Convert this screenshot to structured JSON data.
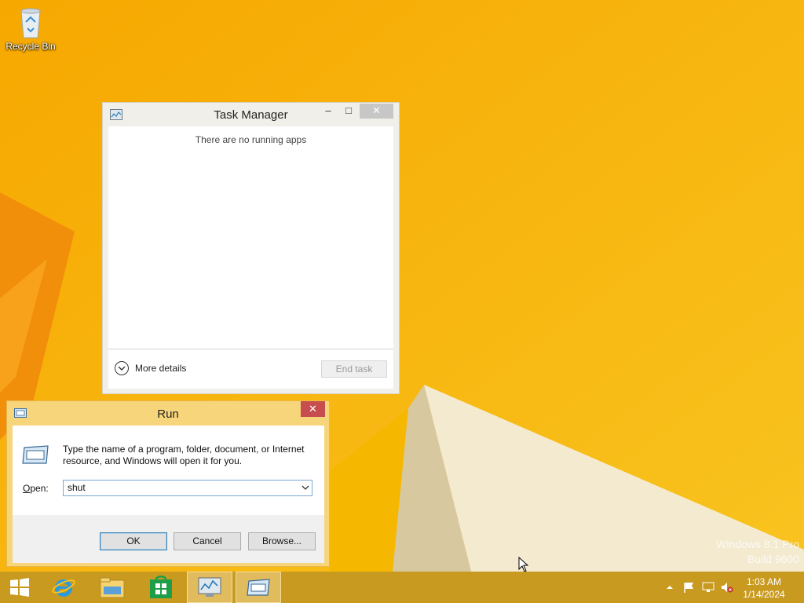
{
  "desktop": {
    "recycle_bin_label": "Recycle Bin",
    "watermark_line1": "Windows 8.1 Pro",
    "watermark_line2": "Build 9600"
  },
  "task_manager": {
    "title": "Task Manager",
    "minimize": "–",
    "maximize": "□",
    "close": "✕",
    "empty_message": "There are no running apps",
    "more_details_label": "More details",
    "end_task_label": "End task"
  },
  "run_dialog": {
    "title": "Run",
    "close": "✕",
    "description": "Type the name of a program, folder, document, or Internet resource, and Windows will open it for you.",
    "open_label_prefix": "O",
    "open_label_rest": "pen:",
    "open_value": "shut",
    "ok_label": "OK",
    "cancel_label": "Cancel",
    "browse_label": "Browse..."
  },
  "taskbar": {
    "items": [
      {
        "name": "start-button",
        "icon": "windows-logo-icon"
      },
      {
        "name": "internet-explorer",
        "icon": "ie-icon"
      },
      {
        "name": "file-explorer",
        "icon": "folder-icon"
      },
      {
        "name": "store",
        "icon": "store-icon"
      },
      {
        "name": "task-manager",
        "icon": "task-manager-icon"
      },
      {
        "name": "run",
        "icon": "run-icon"
      }
    ],
    "time": "1:03 AM",
    "date": "1/14/2024"
  },
  "colors": {
    "desktop_bg": "#f5b400",
    "taskbar_bg": "#c99a20",
    "run_frame": "#f7d57a",
    "close_red": "#c74e4e"
  }
}
